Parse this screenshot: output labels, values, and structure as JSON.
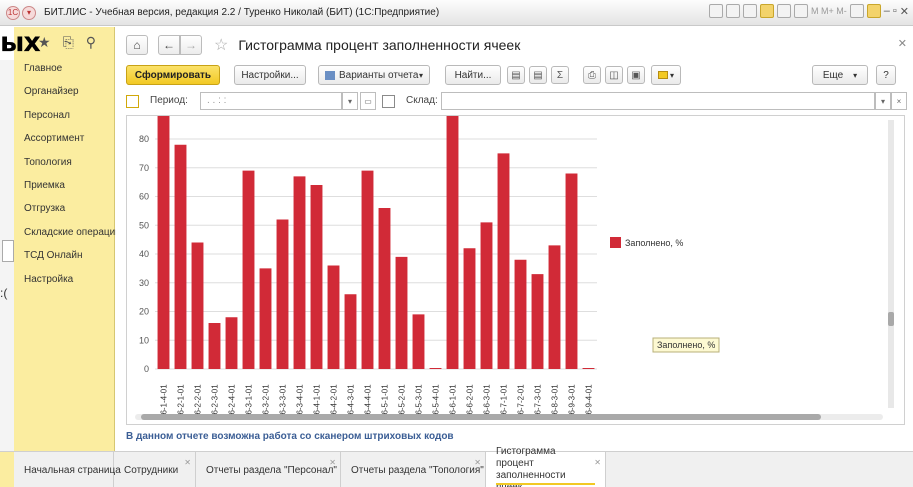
{
  "window": {
    "title": "БИТ.ЛИС - Учебная версия, редакция 2.2 / Туренко Николай (БИТ)  (1С:Предприятие)",
    "toolbar_text": "M  M+  M-"
  },
  "sidebar": {
    "items": [
      {
        "label": "Главное"
      },
      {
        "label": "Органайзер"
      },
      {
        "label": "Персонал"
      },
      {
        "label": "Ассортимент"
      },
      {
        "label": "Топология"
      },
      {
        "label": "Приемка"
      },
      {
        "label": "Отгрузка"
      },
      {
        "label": "Складские операции"
      },
      {
        "label": "ТСД Онлайн"
      },
      {
        "label": "Настройка"
      }
    ],
    "overlay_text": "ых",
    "strip_text": ":("
  },
  "page": {
    "title": "Гистограмма процент заполненности ячеек",
    "hint": "В данном отчете возможна работа со сканером штриховых кодов"
  },
  "toolbar": {
    "generate": "Сформировать",
    "settings": "Настройки...",
    "variants": "Варианты отчета",
    "find": "Найти...",
    "sum": "Σ",
    "more": "Еще",
    "help": "?"
  },
  "params": {
    "period_label": "Период:",
    "period_value": ". .   : :",
    "warehouse_label": "Склад:",
    "warehouse_value": ""
  },
  "chart_data": {
    "type": "bar",
    "categories": [
      "46-1-4-01",
      "46-2-1-01",
      "46-2-2-01",
      "46-2-3-01",
      "46-2-4-01",
      "46-3-1-01",
      "46-3-2-01",
      "46-3-3-01",
      "46-3-4-01",
      "46-4-1-01",
      "46-4-2-01",
      "46-4-3-01",
      "46-4-4-01",
      "46-5-1-01",
      "46-5-2-01",
      "46-5-3-01",
      "46-5-4-01",
      "46-6-1-01",
      "46-6-2-01",
      "46-6-3-01",
      "46-7-1-01",
      "46-7-2-01",
      "46-7-3-01",
      "46-8-3-01",
      "46-9-3-01",
      "46-9-4-01"
    ],
    "series": [
      {
        "name": "Заполнено, %",
        "values": [
          88,
          78,
          44,
          16,
          18,
          69,
          35,
          52,
          67,
          64,
          36,
          26,
          69,
          56,
          39,
          19,
          0,
          88,
          42,
          51,
          75,
          38,
          33,
          43,
          68,
          0
        ]
      }
    ],
    "ylim": [
      0,
      88
    ],
    "yticks": [
      0,
      10,
      20,
      30,
      40,
      50,
      60,
      70,
      80
    ],
    "grid": true,
    "legend": "right",
    "bar_color": "#d12a37",
    "tooltip": "Заполнено, %"
  },
  "tabs": [
    {
      "label": "Начальная страница"
    },
    {
      "label": "Сотрудники"
    },
    {
      "label": "Отчеты раздела \"Персонал\""
    },
    {
      "label": "Отчеты раздела \"Топология\""
    },
    {
      "label": "Гистограмма процент заполненности ячеек"
    }
  ],
  "icons": {
    "home": "home-icon",
    "back": "back-arrow-icon",
    "forward": "forward-arrow-icon",
    "favorite": "star-icon"
  }
}
